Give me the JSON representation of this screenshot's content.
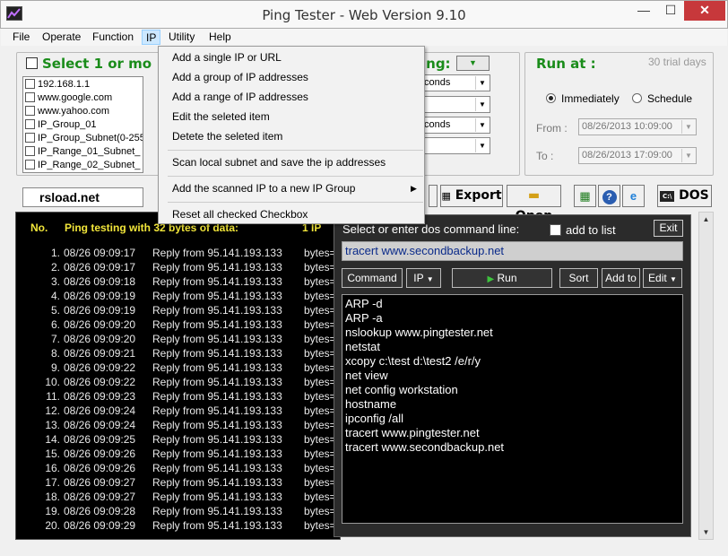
{
  "window": {
    "title": "Ping Tester - Web Version  9.10",
    "minimize": "—",
    "maximize": "☐",
    "close": "✕"
  },
  "menubar": [
    "File",
    "Operate",
    "Function",
    "IP",
    "Utility",
    "Help"
  ],
  "ip_menu": {
    "items": [
      "Add a single IP or URL",
      "Add a group of IP addresses",
      "Add a range of IP addresses",
      "Edit the seleted item",
      "Detete the seleted item",
      "Scan local subnet and save the ip addresses",
      "Add the scanned IP to a new IP Group",
      "Reset all checked Checkbox"
    ],
    "submenu_arrow": "▶"
  },
  "select_box": {
    "title": "Select 1 or mo",
    "items": [
      "192.168.1.1",
      "www.google.com",
      "www.yahoo.com",
      "IP_Group_01",
      "IP_Group_Subnet(0-255",
      "IP_Range_01_Subnet_",
      "IP_Range_02_Subnet_"
    ]
  },
  "ping_settings": {
    "title": "ing:",
    "dropdowns": [
      "conds",
      "",
      "conds",
      ""
    ]
  },
  "run_at": {
    "title": "Run at :",
    "trial": "30 trial days",
    "radio_immediately": "Immediately",
    "radio_schedule": "Schedule",
    "from_label": "From :",
    "from_value": "08/26/2013 10:09:00",
    "to_label": "To :",
    "to_value": "08/26/2013 17:09:00"
  },
  "toolbar": {
    "host": "rsload.net",
    "export": "Export",
    "open": "Open",
    "dos": "DOS"
  },
  "results": {
    "header_no": "No.",
    "header_text": "Ping testing with 32 bytes of data:",
    "header_tail": "1   IP",
    "rows": [
      {
        "no": "1.",
        "time": "08/26 09:09:17",
        "reply": "Reply from 95.141.193.133",
        "bytes": "bytes="
      },
      {
        "no": "2.",
        "time": "08/26 09:09:17",
        "reply": "Reply from 95.141.193.133",
        "bytes": "bytes="
      },
      {
        "no": "3.",
        "time": "08/26 09:09:18",
        "reply": "Reply from 95.141.193.133",
        "bytes": "bytes="
      },
      {
        "no": "4.",
        "time": "08/26 09:09:19",
        "reply": "Reply from 95.141.193.133",
        "bytes": "bytes="
      },
      {
        "no": "5.",
        "time": "08/26 09:09:19",
        "reply": "Reply from 95.141.193.133",
        "bytes": "bytes="
      },
      {
        "no": "6.",
        "time": "08/26 09:09:20",
        "reply": "Reply from 95.141.193.133",
        "bytes": "bytes="
      },
      {
        "no": "7.",
        "time": "08/26 09:09:20",
        "reply": "Reply from 95.141.193.133",
        "bytes": "bytes="
      },
      {
        "no": "8.",
        "time": "08/26 09:09:21",
        "reply": "Reply from 95.141.193.133",
        "bytes": "bytes="
      },
      {
        "no": "9.",
        "time": "08/26 09:09:22",
        "reply": "Reply from 95.141.193.133",
        "bytes": "bytes="
      },
      {
        "no": "10.",
        "time": "08/26 09:09:22",
        "reply": "Reply from 95.141.193.133",
        "bytes": "bytes="
      },
      {
        "no": "11.",
        "time": "08/26 09:09:23",
        "reply": "Reply from 95.141.193.133",
        "bytes": "bytes="
      },
      {
        "no": "12.",
        "time": "08/26 09:09:24",
        "reply": "Reply from 95.141.193.133",
        "bytes": "bytes="
      },
      {
        "no": "13.",
        "time": "08/26 09:09:24",
        "reply": "Reply from 95.141.193.133",
        "bytes": "bytes="
      },
      {
        "no": "14.",
        "time": "08/26 09:09:25",
        "reply": "Reply from 95.141.193.133",
        "bytes": "bytes="
      },
      {
        "no": "15.",
        "time": "08/26 09:09:26",
        "reply": "Reply from 95.141.193.133",
        "bytes": "bytes="
      },
      {
        "no": "16.",
        "time": "08/26 09:09:26",
        "reply": "Reply from 95.141.193.133",
        "bytes": "bytes="
      },
      {
        "no": "17.",
        "time": "08/26 09:09:27",
        "reply": "Reply from 95.141.193.133",
        "bytes": "bytes="
      },
      {
        "no": "18.",
        "time": "08/26 09:09:27",
        "reply": "Reply from 95.141.193.133",
        "bytes": "bytes="
      },
      {
        "no": "19.",
        "time": "08/26 09:09:28",
        "reply": "Reply from 95.141.193.133",
        "bytes": "bytes="
      },
      {
        "no": "20.",
        "time": "08/26 09:09:29",
        "reply": "Reply from 95.141.193.133",
        "bytes": "bytes="
      }
    ]
  },
  "dos": {
    "title": "Select or enter dos command line:",
    "add_to_list": "add to list",
    "exit": "Exit",
    "command_value": "tracert www.secondbackup.net",
    "btn_command": "Command",
    "btn_ip": "IP",
    "btn_run": "Run",
    "btn_sort": "Sort",
    "btn_addto": "Add to",
    "btn_edit": "Edit",
    "commands": [
      "ARP -d",
      "ARP -a",
      "nslookup www.pingtester.net",
      "netstat",
      "xcopy c:\\test d:\\test2 /e/r/y",
      "net view",
      "net config workstation",
      "hostname",
      "ipconfig /all",
      "tracert www.pingtester.net",
      "tracert www.secondbackup.net"
    ]
  },
  "colors": {
    "green_title": "#1a8c1a",
    "header_yellow": "#f2e63a",
    "close_red": "#c7383b",
    "menu_highlight": "#cce8ff"
  }
}
